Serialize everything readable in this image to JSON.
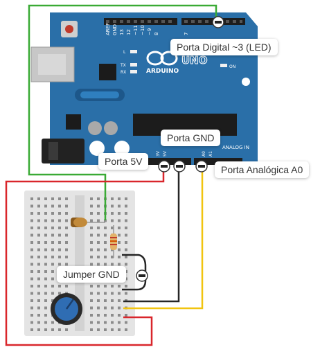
{
  "board": {
    "brand": "ARDUINO",
    "model": "UNO",
    "icon": "arduino-infinity-logo",
    "pins": {
      "aref": "AREF",
      "gnd": "GND",
      "d13": "13",
      "d12": "12",
      "d11": "~11",
      "d10": "~10",
      "d9": "~9",
      "d8": "8",
      "d7": "7",
      "tx": "TX",
      "rx": "RX",
      "l": "L",
      "on": "ON",
      "analog_in": "ANALOG IN",
      "a0": "A0",
      "a1": "A1",
      "power_3v": "3V",
      "power_5v": "5V"
    }
  },
  "labels": {
    "digital3": "Porta Digital ~3 (LED)",
    "gnd": "Porta GND",
    "p5v": "Porta 5V",
    "a0": "Porta Analógica A0",
    "jumper": "Jumper GND"
  },
  "colors": {
    "board": "#2a6fa8",
    "board_dark": "#1d578a",
    "wire_green": "#3aaa35",
    "wire_red": "#d9262b",
    "wire_black": "#262626",
    "wire_yellow": "#f1c40f",
    "breadboard": "#e4e4e4",
    "led": "#c28a3a",
    "pot": "#2f6db3"
  }
}
